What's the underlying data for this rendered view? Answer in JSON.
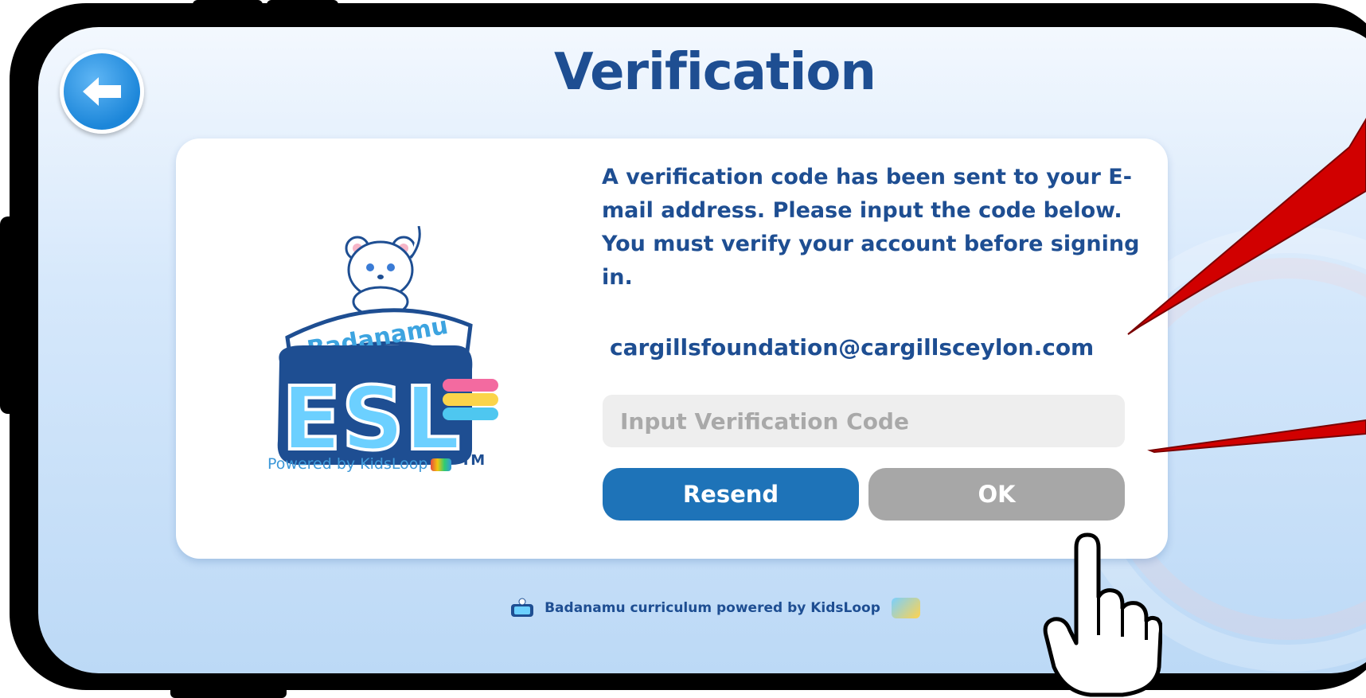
{
  "page": {
    "title": "Verification",
    "back_icon": "arrow-left-icon"
  },
  "logo": {
    "brand_top": "Badanamu",
    "brand_main": "ESL",
    "trademark": "TM",
    "powered_by": "Powered by KidsLoop"
  },
  "verification": {
    "message": "A verification code has been sent to your E-mail address.  Please input the code below. You must verify your account before signing in.",
    "email": "cargillsfoundation@cargillsceylon.com",
    "input_value": "",
    "input_placeholder": "Input Verification Code"
  },
  "buttons": {
    "resend_label": "Resend",
    "ok_label": "OK"
  },
  "footer": {
    "text": "Badanamu curriculum powered by KidsLoop"
  },
  "colors": {
    "title": "#1e4e92",
    "resend_bg": "#1e73b8",
    "ok_bg_disabled": "#a7a7a7",
    "annotation_arrow": "#d10000"
  }
}
